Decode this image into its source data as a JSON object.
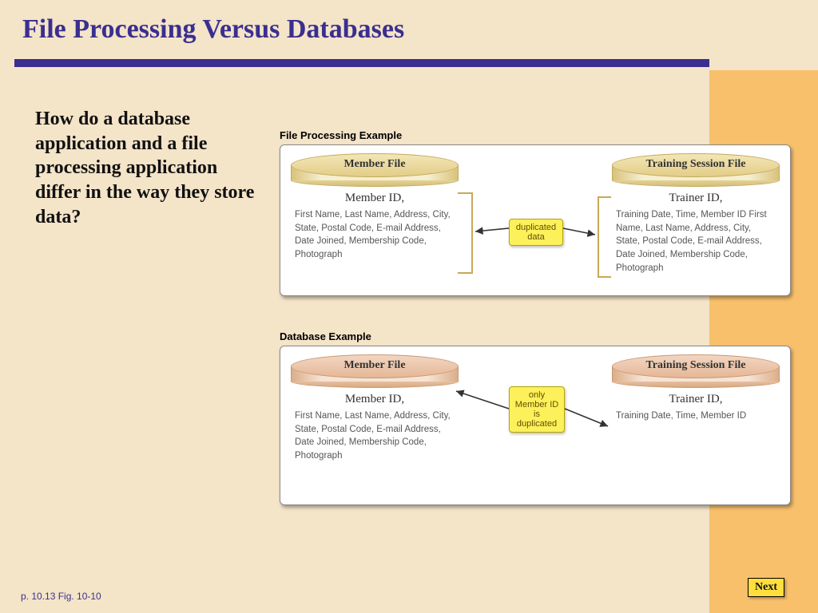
{
  "title": "File Processing Versus Databases",
  "question": "How do a database application and a file processing application differ in the way they store data?",
  "panel1": {
    "heading": "File Processing Example",
    "left_title": "Member File",
    "left_id": "Member ID,",
    "left_fields": "First Name, Last Name, Address, City, State, Postal Code, E-mail Address, Date Joined, Membership Code, Photograph",
    "right_title": "Training Session File",
    "right_id": "Trainer ID,",
    "right_fields": "Training Date, Time, Member ID First Name, Last Name, Address, City, State, Postal Code, E-mail Address, Date Joined, Membership Code, Photograph",
    "note": "duplicated data"
  },
  "panel2": {
    "heading": "Database Example",
    "left_title": "Member File",
    "left_id": "Member ID,",
    "left_fields": "First Name, Last Name, Address, City, State, Postal Code, E-mail Address, Date Joined, Membership Code, Photograph",
    "right_title": "Training Session File",
    "right_id": "Trainer ID,",
    "right_fields": "Training Date, Time, Member ID",
    "note": "only Member ID is duplicated"
  },
  "footer": "p. 10.13 Fig. 10-10",
  "next": "Next"
}
